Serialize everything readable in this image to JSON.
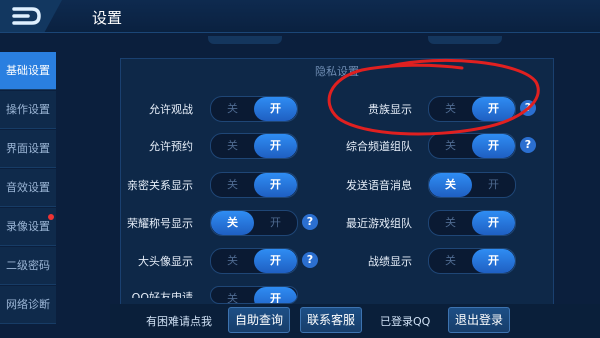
{
  "header": {
    "title": "设置"
  },
  "sidebar": {
    "items": [
      {
        "label": "基础设置",
        "active": true
      },
      {
        "label": "操作设置"
      },
      {
        "label": "界面设置"
      },
      {
        "label": "音效设置"
      },
      {
        "label": "录像设置",
        "badge": "red-dot"
      },
      {
        "label": "二级密码"
      },
      {
        "label": "网络诊断"
      }
    ]
  },
  "section": {
    "title": "隐私设置"
  },
  "settings": {
    "allow_watch": {
      "label": "允许观战",
      "off": "关",
      "on": "开",
      "state": "on"
    },
    "allow_reserve": {
      "label": "允许预约",
      "off": "关",
      "on": "开",
      "state": "on"
    },
    "intimate_show": {
      "label": "亲密关系显示",
      "off": "关",
      "on": "开",
      "state": "on"
    },
    "honor_title": {
      "label": "荣耀称号显示",
      "off": "关",
      "on": "开",
      "state": "off"
    },
    "big_avatar": {
      "label": "大头像显示",
      "off": "关",
      "on": "开",
      "state": "on"
    },
    "qq_friend": {
      "label": "QQ好友申请",
      "off": "关",
      "on": "开",
      "state": "on"
    },
    "noble_show": {
      "label": "贵族显示",
      "off": "关",
      "on": "开",
      "state": "on"
    },
    "channel_team": {
      "label": "综合频道组队",
      "off": "关",
      "on": "开",
      "state": "on"
    },
    "voice_msg": {
      "label": "发送语音消息",
      "off": "关",
      "on": "开",
      "state": "off"
    },
    "recent_team": {
      "label": "最近游戏组队",
      "off": "关",
      "on": "开",
      "state": "on"
    },
    "record_show": {
      "label": "战绩显示",
      "off": "关",
      "on": "开",
      "state": "on"
    }
  },
  "help_icon": "?",
  "footer": {
    "help_text": "有困难请点我",
    "self_query": "自助查询",
    "contact": "联系客服",
    "logged_in": "已登录QQ",
    "logout": "退出登录"
  },
  "colors": {
    "accent": "#2a7fe0",
    "annotation": "#e02020"
  }
}
